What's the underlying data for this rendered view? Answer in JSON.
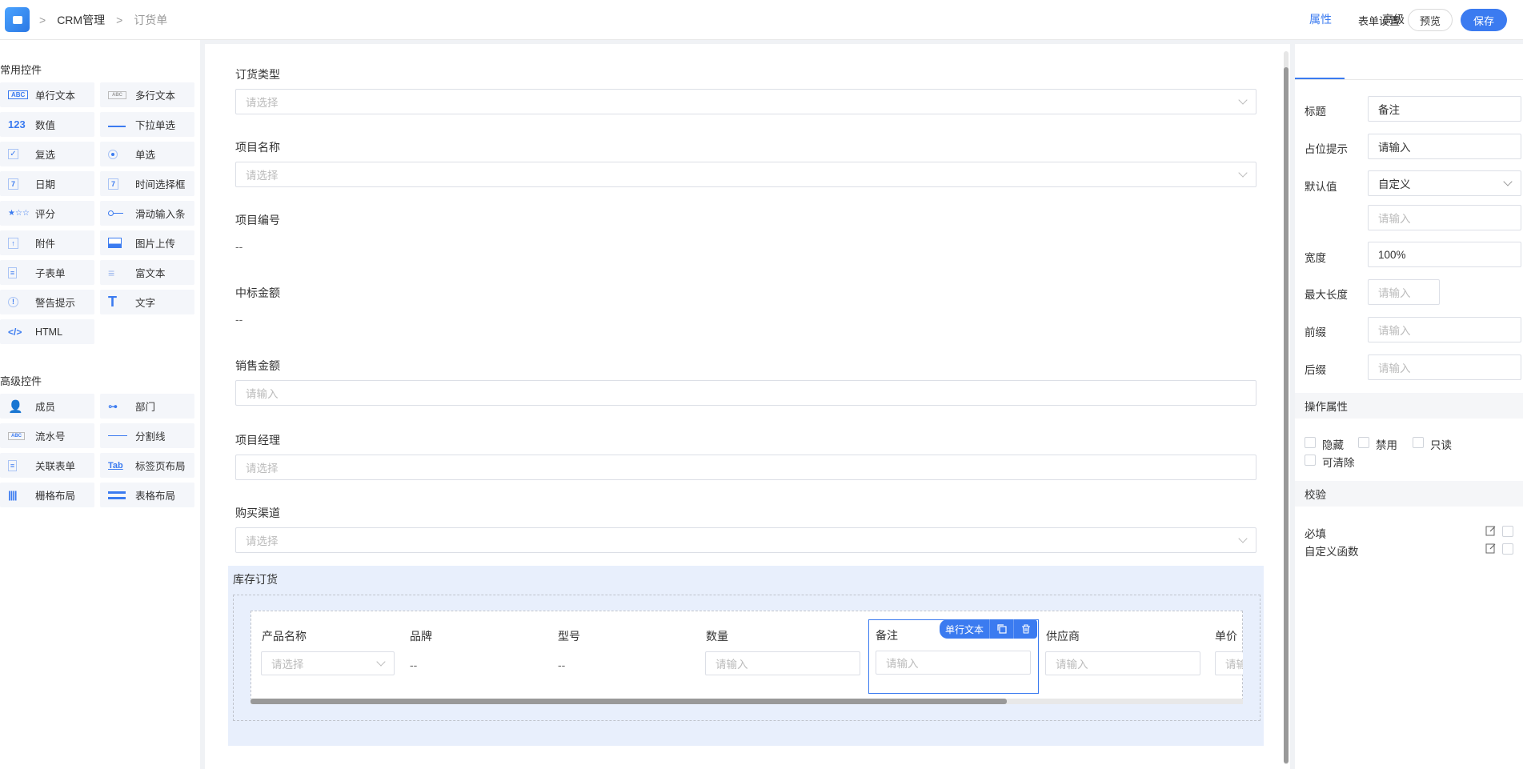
{
  "header": {
    "breadcrumb": [
      "CRM管理",
      "订货单"
    ],
    "form_settings": "表单设置",
    "preview": "预览",
    "save": "保存"
  },
  "palette": {
    "common_title": "常用控件",
    "common": [
      {
        "label": "单行文本",
        "icon": "abc-icon"
      },
      {
        "label": "多行文本",
        "icon": "abc-multiline-icon"
      },
      {
        "label": "数值",
        "icon": "number-icon"
      },
      {
        "label": "下拉单选",
        "icon": "dropdown-icon"
      },
      {
        "label": "复选",
        "icon": "checkbox-icon"
      },
      {
        "label": "单选",
        "icon": "radio-icon"
      },
      {
        "label": "日期",
        "icon": "calendar-icon"
      },
      {
        "label": "时间选择框",
        "icon": "time-calendar-icon"
      },
      {
        "label": "评分",
        "icon": "star-icon"
      },
      {
        "label": "滑动输入条",
        "icon": "slider-icon"
      },
      {
        "label": "附件",
        "icon": "upload-icon"
      },
      {
        "label": "图片上传",
        "icon": "image-icon"
      },
      {
        "label": "子表单",
        "icon": "subform-icon"
      },
      {
        "label": "富文本",
        "icon": "richtext-icon"
      },
      {
        "label": "警告提示",
        "icon": "alert-icon"
      },
      {
        "label": "文字",
        "icon": "text-icon"
      },
      {
        "label": "HTML",
        "icon": "code-icon"
      }
    ],
    "advanced_title": "高级控件",
    "advanced": [
      {
        "label": "成员",
        "icon": "user-icon"
      },
      {
        "label": "部门",
        "icon": "org-icon"
      },
      {
        "label": "流水号",
        "icon": "serial-icon"
      },
      {
        "label": "分割线",
        "icon": "divider-icon"
      },
      {
        "label": "关联表单",
        "icon": "link-form-icon"
      },
      {
        "label": "标签页布局",
        "icon": "tab-icon"
      },
      {
        "label": "栅格布局",
        "icon": "grid-icon"
      },
      {
        "label": "表格布局",
        "icon": "table-icon"
      }
    ],
    "icon_text": {
      "abc": "ABC",
      "num": "123",
      "tab": "Tab",
      "code": "</>",
      "text": "T",
      "date": "7"
    }
  },
  "form": {
    "fields": [
      {
        "label": "订货类型",
        "placeholder": "请选择"
      },
      {
        "label": "项目名称",
        "placeholder": "请选择"
      },
      {
        "label": "项目编号",
        "value": "--"
      },
      {
        "label": "中标金额",
        "value": "--"
      },
      {
        "label": "销售金额",
        "placeholder": "请输入"
      },
      {
        "label": "项目经理",
        "placeholder": "请选择"
      },
      {
        "label": "购买渠道",
        "placeholder": "请选择"
      }
    ],
    "subtable": {
      "title": "库存订货",
      "columns": [
        {
          "label": "产品名称",
          "placeholder": "请选择"
        },
        {
          "label": "品牌",
          "value": "--"
        },
        {
          "label": "型号",
          "value": "--"
        },
        {
          "label": "数量",
          "placeholder": "请输入"
        },
        {
          "label": "备注",
          "placeholder": "请输入"
        },
        {
          "label": "供应商",
          "placeholder": "请输入"
        },
        {
          "label": "单价",
          "placeholder": "请输"
        }
      ],
      "selected_tag": "单行文本"
    }
  },
  "props": {
    "tabs": [
      "属性",
      "高级"
    ],
    "title_label": "标题",
    "title_value": "备注",
    "placeholder_label": "占位提示",
    "placeholder_value": "请输入",
    "default_label": "默认值",
    "default_value": "自定义",
    "default_input_ph": "请输入",
    "width_label": "宽度",
    "width_value": "100%",
    "maxlen_label": "最大长度",
    "maxlen_ph": "请输入",
    "prefix_label": "前缀",
    "prefix_ph": "请输入",
    "suffix_label": "后缀",
    "suffix_ph": "请输入",
    "ops_title": "操作属性",
    "ops": [
      "隐藏",
      "禁用",
      "只读",
      "可清除"
    ],
    "validate_title": "校验",
    "validate": [
      "必填",
      "自定义函数"
    ]
  },
  "colors": {
    "accent": "#3b7bf0",
    "selected_bg": "#e8effc"
  }
}
